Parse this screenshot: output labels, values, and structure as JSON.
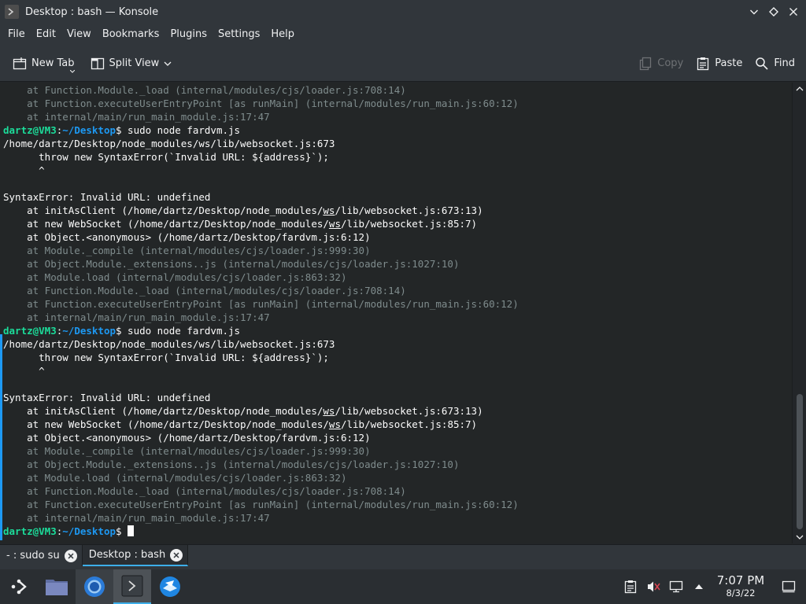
{
  "window": {
    "title": "Desktop : bash — Konsole"
  },
  "menu": [
    "File",
    "Edit",
    "View",
    "Bookmarks",
    "Plugins",
    "Settings",
    "Help"
  ],
  "toolbar": {
    "new_tab": "New Tab",
    "split_view": "Split View",
    "copy": "Copy",
    "paste": "Paste",
    "find": "Find"
  },
  "terminal": {
    "lines": [
      {
        "type": "dim",
        "text": "    at Function.Module._load (internal/modules/cjs/loader.js:708:14)"
      },
      {
        "type": "dim",
        "text": "    at Function.executeUserEntryPoint [as runMain] (internal/modules/run_main.js:60:12)"
      },
      {
        "type": "dim",
        "text": "    at internal/main/run_main_module.js:17:47"
      },
      {
        "type": "prompt",
        "user": "dartz@VM3",
        "path": "~/Desktop",
        "command": " sudo node fardvm.js"
      },
      {
        "type": "normal",
        "text": "/home/dartz/Desktop/node_modules/ws/lib/websocket.js:673"
      },
      {
        "type": "normal",
        "text": "      throw new SyntaxError(`Invalid URL: ${address}`);"
      },
      {
        "type": "normal",
        "text": "      ^"
      },
      {
        "type": "normal",
        "text": ""
      },
      {
        "type": "normal",
        "text": "SyntaxError: Invalid URL: undefined"
      },
      {
        "type": "ws",
        "pre": "    at initAsClient (/home/dartz/Desktop/node_modules/",
        "ws": "ws",
        "post": "/lib/websocket.js:673:13)"
      },
      {
        "type": "ws",
        "pre": "    at new WebSocket (/home/dartz/Desktop/node_modules/",
        "ws": "ws",
        "post": "/lib/websocket.js:85:7)"
      },
      {
        "type": "normal",
        "text": "    at Object.<anonymous> (/home/dartz/Desktop/fardvm.js:6:12)"
      },
      {
        "type": "dim",
        "text": "    at Module._compile (internal/modules/cjs/loader.js:999:30)"
      },
      {
        "type": "dim",
        "text": "    at Object.Module._extensions..js (internal/modules/cjs/loader.js:1027:10)"
      },
      {
        "type": "dim",
        "text": "    at Module.load (internal/modules/cjs/loader.js:863:32)"
      },
      {
        "type": "dim",
        "text": "    at Function.Module._load (internal/modules/cjs/loader.js:708:14)"
      },
      {
        "type": "dim",
        "text": "    at Function.executeUserEntryPoint [as runMain] (internal/modules/run_main.js:60:12)"
      },
      {
        "type": "dim",
        "text": "    at internal/main/run_main_module.js:17:47"
      },
      {
        "type": "prompt",
        "user": "dartz@VM3",
        "path": "~/Desktop",
        "command": " sudo node fardvm.js"
      },
      {
        "type": "normal",
        "text": "/home/dartz/Desktop/node_modules/ws/lib/websocket.js:673"
      },
      {
        "type": "normal",
        "text": "      throw new SyntaxError(`Invalid URL: ${address}`);"
      },
      {
        "type": "normal",
        "text": "      ^"
      },
      {
        "type": "normal",
        "text": ""
      },
      {
        "type": "normal",
        "text": "SyntaxError: Invalid URL: undefined"
      },
      {
        "type": "ws",
        "pre": "    at initAsClient (/home/dartz/Desktop/node_modules/",
        "ws": "ws",
        "post": "/lib/websocket.js:673:13)"
      },
      {
        "type": "ws",
        "pre": "    at new WebSocket (/home/dartz/Desktop/node_modules/",
        "ws": "ws",
        "post": "/lib/websocket.js:85:7)"
      },
      {
        "type": "normal",
        "text": "    at Object.<anonymous> (/home/dartz/Desktop/fardvm.js:6:12)"
      },
      {
        "type": "dim",
        "text": "    at Module._compile (internal/modules/cjs/loader.js:999:30)"
      },
      {
        "type": "dim",
        "text": "    at Object.Module._extensions..js (internal/modules/cjs/loader.js:1027:10)"
      },
      {
        "type": "dim",
        "text": "    at Module.load (internal/modules/cjs/loader.js:863:32)"
      },
      {
        "type": "dim",
        "text": "    at Function.Module._load (internal/modules/cjs/loader.js:708:14)"
      },
      {
        "type": "dim",
        "text": "    at Function.executeUserEntryPoint [as runMain] (internal/modules/run_main.js:60:12)"
      },
      {
        "type": "dim",
        "text": "    at internal/main/run_main_module.js:17:47"
      },
      {
        "type": "prompt",
        "user": "dartz@VM3",
        "path": "~/Desktop",
        "command": " ",
        "cursor": true
      }
    ]
  },
  "tabs": [
    {
      "label": "- : sudo su",
      "active": false
    },
    {
      "label": "Desktop : bash",
      "active": true
    }
  ],
  "taskbar": {
    "apps": [
      {
        "icon": "application-launcher-icon",
        "state": "normal"
      },
      {
        "icon": "file-manager-icon",
        "state": "normal"
      },
      {
        "icon": "browser-icon",
        "state": "running"
      },
      {
        "icon": "konsole-icon",
        "state": "active"
      },
      {
        "icon": "thunderbird-icon",
        "state": "normal"
      }
    ],
    "clock": {
      "time": "7:07 PM",
      "date": "8/3/22"
    }
  },
  "colors": {
    "accent": "#3daee9",
    "prompt_user": "#1cdc9a",
    "prompt_path": "#1d99f3",
    "terminal_bg": "#232627"
  }
}
